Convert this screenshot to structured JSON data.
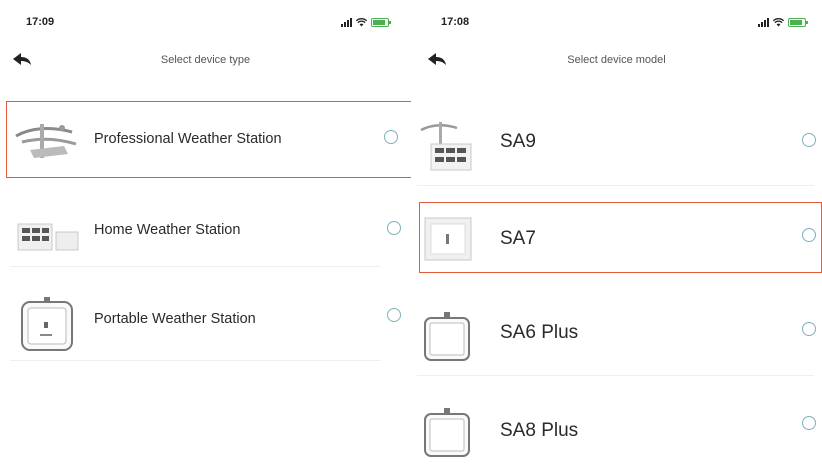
{
  "colors": {
    "highlight": "#e05a3b",
    "radio": "#7fb0bd",
    "battery": "#4caf50"
  },
  "left_screen": {
    "status_time": "17:09",
    "title": "Select device type",
    "back_icon": "back-arrow-icon",
    "items": [
      {
        "label": "Professional Weather Station",
        "icon": "professional-station-icon",
        "selected_highlight": true
      },
      {
        "label": "Home Weather Station",
        "icon": "home-station-icon",
        "selected_highlight": false
      },
      {
        "label": "Portable Weather Station",
        "icon": "portable-station-icon",
        "selected_highlight": false
      }
    ]
  },
  "right_screen": {
    "status_time": "17:08",
    "title": "Select device model",
    "back_icon": "back-arrow-icon",
    "items": [
      {
        "label": "SA9",
        "icon": "sa9-device-icon",
        "selected_highlight": false
      },
      {
        "label": "SA7",
        "icon": "sa7-device-icon",
        "selected_highlight": true
      },
      {
        "label": "SA6 Plus",
        "icon": "sa6-plus-device-icon",
        "selected_highlight": false
      },
      {
        "label": "SA8 Plus",
        "icon": "sa8-plus-device-icon",
        "selected_highlight": false
      }
    ]
  }
}
